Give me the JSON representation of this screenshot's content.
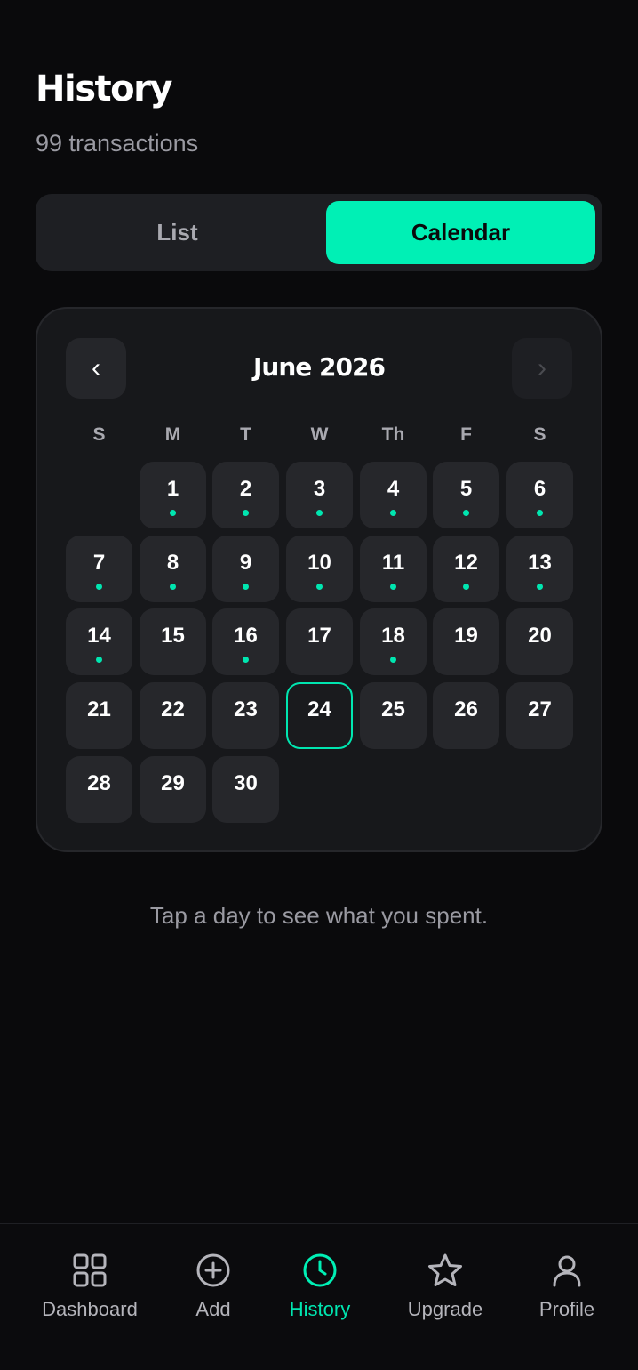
{
  "header": {
    "title": "History",
    "subtitle": "99 transactions"
  },
  "view_toggle": {
    "list_label": "List",
    "calendar_label": "Calendar",
    "selected": "Calendar"
  },
  "calendar": {
    "month_label": "June 2026",
    "prev_symbol": "‹",
    "next_symbol": "›",
    "weekdays": [
      "S",
      "M",
      "T",
      "W",
      "Th",
      "F",
      "S"
    ],
    "first_weekday_index": 1,
    "selected_day": 24,
    "days": [
      {
        "label": "1",
        "has_spending": true
      },
      {
        "label": "2",
        "has_spending": true
      },
      {
        "label": "3",
        "has_spending": true
      },
      {
        "label": "4",
        "has_spending": true
      },
      {
        "label": "5",
        "has_spending": true
      },
      {
        "label": "6",
        "has_spending": true
      },
      {
        "label": "7",
        "has_spending": true
      },
      {
        "label": "8",
        "has_spending": true
      },
      {
        "label": "9",
        "has_spending": true
      },
      {
        "label": "10",
        "has_spending": true
      },
      {
        "label": "11",
        "has_spending": true
      },
      {
        "label": "12",
        "has_spending": true
      },
      {
        "label": "13",
        "has_spending": true
      },
      {
        "label": "14",
        "has_spending": true
      },
      {
        "label": "15",
        "has_spending": false
      },
      {
        "label": "16",
        "has_spending": true
      },
      {
        "label": "17",
        "has_spending": false
      },
      {
        "label": "18",
        "has_spending": true
      },
      {
        "label": "19",
        "has_spending": false
      },
      {
        "label": "20",
        "has_spending": false
      },
      {
        "label": "21",
        "has_spending": false
      },
      {
        "label": "22",
        "has_spending": false
      },
      {
        "label": "23",
        "has_spending": false
      },
      {
        "label": "24",
        "has_spending": false
      },
      {
        "label": "25",
        "has_spending": false
      },
      {
        "label": "26",
        "has_spending": false
      },
      {
        "label": "27",
        "has_spending": false
      },
      {
        "label": "28",
        "has_spending": false
      },
      {
        "label": "29",
        "has_spending": false
      },
      {
        "label": "30",
        "has_spending": false
      }
    ]
  },
  "hint": "Tap a day to see what you spent.",
  "bottom_nav": [
    {
      "label": "Dashboard",
      "icon": "grid-icon",
      "active": false
    },
    {
      "label": "Add",
      "icon": "plus-circle-icon",
      "active": false
    },
    {
      "label": "History",
      "icon": "clock-icon",
      "active": true
    },
    {
      "label": "Upgrade",
      "icon": "star-icon",
      "active": false
    },
    {
      "label": "Profile",
      "icon": "user-icon",
      "active": false
    }
  ],
  "colors": {
    "accent": "#00F0B5",
    "background": "#0A0A0C",
    "card": "#17181B",
    "day_cell": "#26272B",
    "muted_text": "#9A9AA2"
  }
}
